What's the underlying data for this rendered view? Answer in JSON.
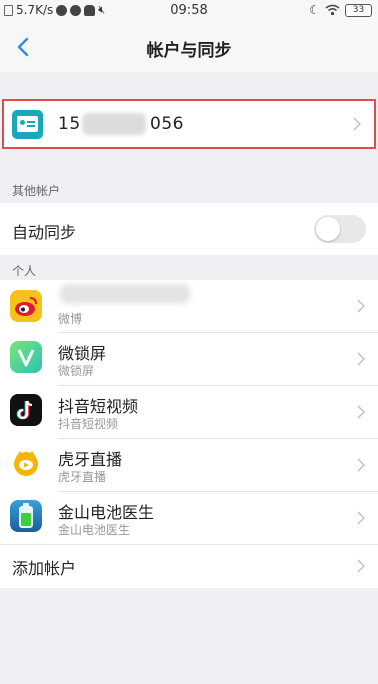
{
  "status_bar": {
    "speed": "5.7K/s",
    "time": "09:58",
    "battery": "33"
  },
  "header": {
    "title": "帐户与同步"
  },
  "account": {
    "number_start": "15",
    "number_end": "056"
  },
  "other_accounts": {
    "section_label": "其他帐户",
    "auto_sync_label": "自动同步",
    "auto_sync_enabled": false
  },
  "personal": {
    "section_label": "个人",
    "items": [
      {
        "icon": "weibo-icon",
        "title": "",
        "subtitle": "微博"
      },
      {
        "icon": "lockscreen-icon",
        "title": "微锁屏",
        "subtitle": "微锁屏"
      },
      {
        "icon": "douyin-icon",
        "title": "抖音短视频",
        "subtitle": "抖音短视频"
      },
      {
        "icon": "huya-icon",
        "title": "虎牙直播",
        "subtitle": "虎牙直播"
      },
      {
        "icon": "battery-doctor-icon",
        "title": "金山电池医生",
        "subtitle": "金山电池医生"
      }
    ]
  },
  "add_account_label": "添加帐户",
  "colors": {
    "highlight_border": "#e14b4b",
    "back_arrow": "#2a8cf0",
    "background": "#efeff4"
  }
}
